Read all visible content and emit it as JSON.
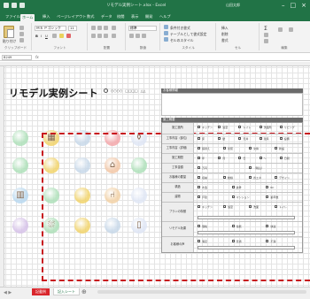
{
  "window": {
    "title": "リモデル実例シート.xlsx - Excel",
    "user": "山田太郎",
    "controls": [
      "–",
      "□",
      "×"
    ]
  },
  "ribbon": {
    "tabs": [
      "ファイル",
      "ホーム",
      "挿入",
      "ページレイアウト",
      "数式",
      "データ",
      "校閲",
      "表示",
      "開発",
      "ヘルプ"
    ],
    "active_tab": "ホーム",
    "clipboard": {
      "paste": "貼り付け",
      "label": "クリップボード"
    },
    "font": {
      "name": "ＭＳ Ｐゴシック",
      "size": "11",
      "label": "フォント"
    },
    "alignment": {
      "label": "配置"
    },
    "number": {
      "format": "標準",
      "label": "数値"
    },
    "styles": {
      "conditional": "条件付き書式",
      "table": "テーブルとして書式設定",
      "cell": "セルのスタイル",
      "label": "スタイル"
    },
    "cells": {
      "insert": "挿入",
      "delete": "削除",
      "format": "書式",
      "label": "セル"
    },
    "editing": {
      "label": "編集"
    }
  },
  "formula_bar": {
    "name_box": "B249",
    "fx": "fx"
  },
  "document": {
    "title": "リモデル実例シート",
    "sub_items": [
      "○○○○",
      "□□□□",
      "△△"
    ]
  },
  "circles": [
    {
      "color": "#aee0b9",
      "icon": ""
    },
    {
      "color": "#f1d36b",
      "icon": "bed-icon",
      "glyph": "▦"
    },
    {
      "color": "#c7d8e9",
      "icon": ""
    },
    {
      "color": "#f3a6a9",
      "icon": ""
    },
    {
      "color": "#dfe6f5",
      "icon": "toilet-icon",
      "glyph": "⚱"
    },
    {
      "color": "#aee0b9",
      "icon": ""
    },
    {
      "color": "#f1d36b",
      "icon": ""
    },
    {
      "color": "#c7d8e9",
      "icon": ""
    },
    {
      "color": "#f3c7a6",
      "icon": "house-icon",
      "glyph": "⌂"
    },
    {
      "color": "#aee0b9",
      "icon": ""
    },
    {
      "color": "#b9d9f0",
      "icon": "window-icon",
      "glyph": "▥"
    },
    {
      "color": "#aee0b9",
      "icon": ""
    },
    {
      "color": "#f1d36b",
      "icon": ""
    },
    {
      "color": "#f3d2a6",
      "icon": "chair-icon",
      "glyph": "⑁"
    },
    {
      "color": "#dfe6f5",
      "icon": ""
    },
    {
      "color": "#d6c2e8",
      "icon": ""
    },
    {
      "color": "#aee0b9",
      "icon": "bath-icon",
      "glyph": "⛆"
    },
    {
      "color": "#f1d36b",
      "icon": ""
    },
    {
      "color": "#c7d8e9",
      "icon": ""
    },
    {
      "color": "#dfe6f5",
      "icon": "door-icon",
      "glyph": "▯"
    }
  ],
  "right_panel": {
    "section1": "お客様情報",
    "section2": "施工概要",
    "rows": [
      {
        "label": "施工箇所",
        "cells": [
          "キッチン",
          "浴室",
          "トイレ",
          "洗面所",
          "リビング"
        ]
      },
      {
        "label": "工事内容（部位）",
        "cells": [
          "床",
          "壁",
          "天井",
          "建具",
          "設備"
        ]
      },
      {
        "label": "工事内容（詳細）",
        "cells": [
          "張替え",
          "塗装",
          "交換",
          "新設"
        ]
      },
      {
        "label": "施工期間",
        "cells": [
          "年",
          "月",
          "日",
          "〜",
          "日間"
        ]
      },
      {
        "label": "工事金額",
        "cells": [
          "万円",
          "（税込）"
        ]
      },
      {
        "label": "お客様の要望",
        "cells": [
          "収納",
          "動線",
          "省エネ",
          "デザイン"
        ]
      },
      {
        "label": "構造",
        "cells": [
          "木造",
          "鉄骨",
          "RC"
        ]
      },
      {
        "label": "建物",
        "cells": [
          "戸建",
          "マンション",
          "築年数"
        ]
      },
      {
        "label": "プランの特徴",
        "cells": [
          "キッチン",
          "浴室",
          "洗面",
          "トイレ"
        ]
      },
      {
        "label": "リモデル効果",
        "cells": [
          "価格",
          "性能",
          "快適"
        ]
      },
      {
        "label": "お客様の声",
        "cells": [
          "満足",
          "普通",
          "不満"
        ]
      }
    ]
  },
  "sheet_tabs": [
    "記載例",
    "記入シート"
  ]
}
